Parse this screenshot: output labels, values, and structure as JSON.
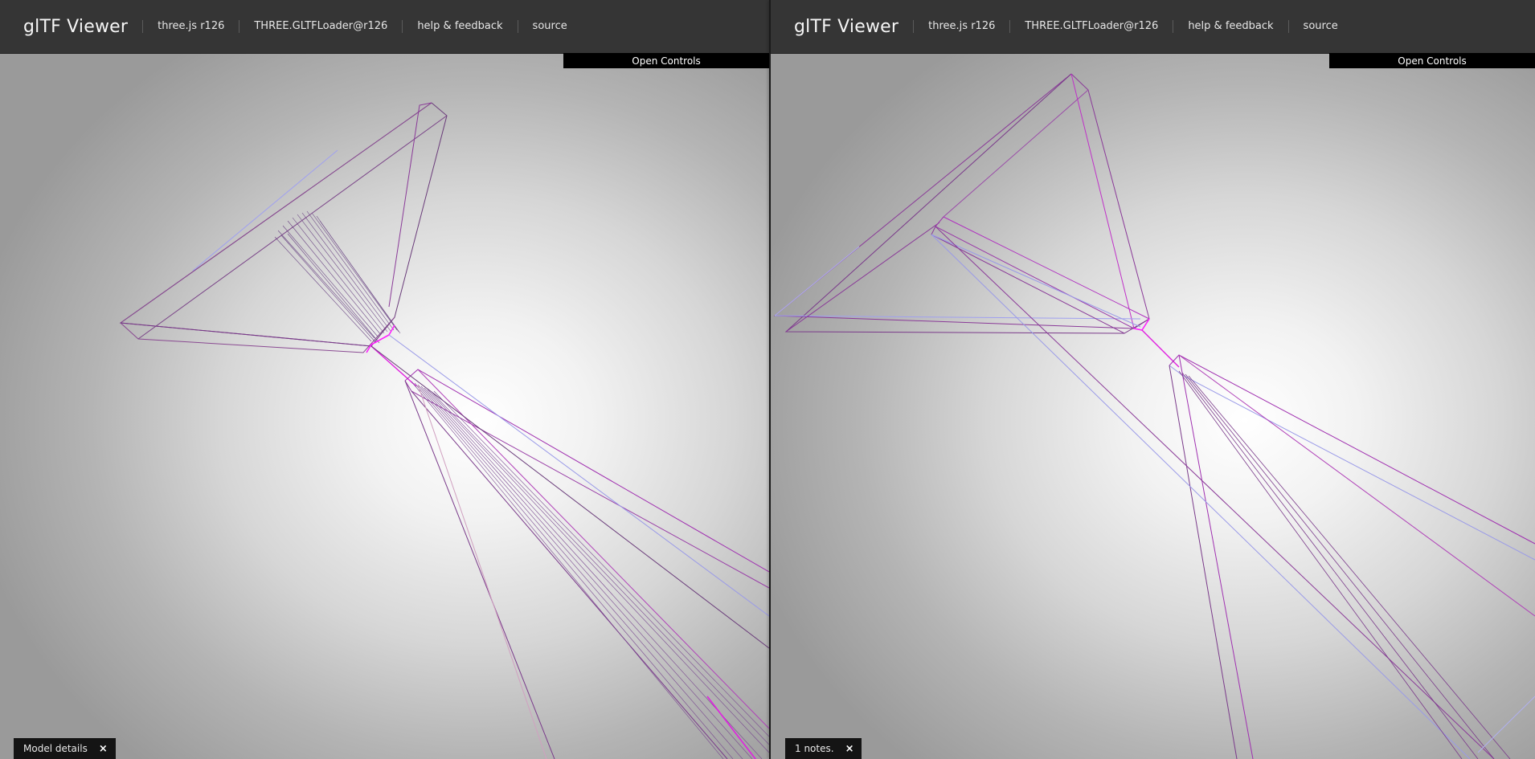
{
  "left": {
    "header": {
      "title": "glTF Viewer",
      "nav": [
        "three.js r126",
        "THREE.GLTFLoader@r126",
        "help & feedback",
        "source"
      ]
    },
    "controls_label": "Open Controls",
    "footer": {
      "label": "Model details",
      "close": "×"
    }
  },
  "right": {
    "header": {
      "title": "glTF Viewer",
      "nav": [
        "three.js r126",
        "THREE.GLTFLoader@r126",
        "help & feedback",
        "source"
      ]
    },
    "controls_label": "Open Controls",
    "footer": {
      "label": "1 notes.",
      "close": "×"
    }
  },
  "colors": {
    "header_bg": "#353535",
    "wire_purple": "#7a3a8a",
    "wire_magenta": "#e020e0",
    "wire_lavender": "#9a9ae8"
  }
}
